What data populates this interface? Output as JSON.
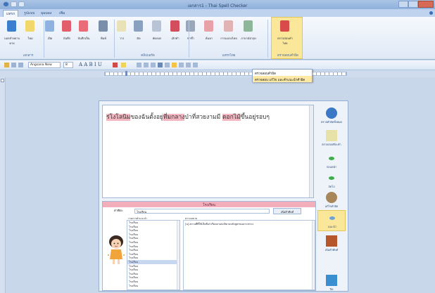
{
  "window": {
    "title": "เอกสาร1 - Thai Spell Checker"
  },
  "tabs": [
    "แทรก",
    "รูปแบบ",
    "มุมมอง",
    "เพิ่ม"
  ],
  "ribbon": {
    "buttons": [
      {
        "label": "บอกคำหยาบคาย",
        "color": "#3d7fcf"
      },
      {
        "label": "ใหม่",
        "color": "#f2d76a"
      },
      {
        "label": "เปิด",
        "color": "#8fb3de"
      },
      {
        "label": "บันทึก",
        "color": "#e25e6a"
      },
      {
        "label": "บันทึกเป็น",
        "color": "#e86d76"
      },
      {
        "label": "พิมพ์",
        "color": "#7b8ea9"
      },
      {
        "label": "วาง",
        "color": "#e9e2b8"
      },
      {
        "label": "ตัด",
        "color": "#8aa1bf"
      },
      {
        "label": "คัดลอก",
        "color": "#b8c4d6"
      },
      {
        "label": "เลิกทำ",
        "color": "#d24e5c"
      },
      {
        "label": "ทำซ้ำ",
        "color": "#9aa7b8"
      },
      {
        "label": "ค้นหา",
        "color": "#e9a1a8"
      },
      {
        "label": "การแปลงไทย",
        "color": "#e2b3b5"
      },
      {
        "label": "ภาษาอังกฤษ",
        "color": "#8fb59a"
      },
      {
        "label": "ตรวจสอบคำไทย",
        "color": "#d94a4a"
      }
    ],
    "groups": [
      "เอกสาร",
      "คลิปบอร์ด",
      "แทรกไทย",
      "ตรวจสอบคำผิด"
    ]
  },
  "toolbar": {
    "font_name": "Angsana New",
    "font_size": "8",
    "format_glyphs": "A A B I U"
  },
  "dropdown": {
    "items": [
      "ตรวจสอบคำผิด",
      "ตรวจสอบ แก้ไข และคำแนะนำคำผิด"
    ]
  },
  "document": {
    "segments": [
      {
        "text": "ร่โงโลนิม",
        "error": true
      },
      {
        "text": "ของฉันตั้งอยู่",
        "error": false
      },
      {
        "text": "ที่มกลาง",
        "error": true
      },
      {
        "text": "ป่าที่สวยงามมี ",
        "error": false
      },
      {
        "text": "ดอกไม้",
        "error": true
      },
      {
        "text": "ขึ้นอยู่รอบๆ",
        "error": false
      }
    ]
  },
  "actions": [
    {
      "label": "ตรวจคำผิดทั้งหมด",
      "color": "#3b79c6"
    },
    {
      "label": "ตรวจสอบทีละคำ",
      "color": "#e6e2a8"
    },
    {
      "label": "ก่อนหน้า",
      "color": "#3fae4a"
    },
    {
      "label": "ถัดไป",
      "color": "#3fae4a"
    },
    {
      "label": "แก้ไขคำผิด",
      "color": "#a8865a"
    },
    {
      "label": "แนะนำ",
      "color": "#6fa3d8"
    },
    {
      "label": "เพิ่มคำศัพท์",
      "color": "#b5572a"
    },
    {
      "label": "ปิด",
      "color": "#3a8fd1"
    }
  ],
  "panel": {
    "heading": "โรงเรียน",
    "word_label": "คำที่ผิด:",
    "word_value": "โรงเรียน",
    "word_button": "เพิ่มคำศัพท์",
    "suggestions_header": "รายการคำแนะนำ",
    "meaning_header": "ความหมาย",
    "suggestions": [
      "โรงเรียน",
      "โรงเรียน",
      "โรงเรียน",
      "โรงเรียน",
      "โรงเรียน",
      "โรงเรียน",
      "โรงเรียน",
      "โรงเรียน",
      "โรงเรียน",
      "โรงเรียน",
      "โรงเรียน",
      "โรงเรียน",
      "โรงเรียน",
      "โรงเรียน",
      "โรงเรียน",
      "โรงเรียน",
      "โรงเรียน"
    ],
    "selected_index": 10,
    "meaning": "[น] สถานที่ที่ใช้เป็นที่เล่าเรียนตามปกติตามหลักสูตรของกระทรวง"
  }
}
